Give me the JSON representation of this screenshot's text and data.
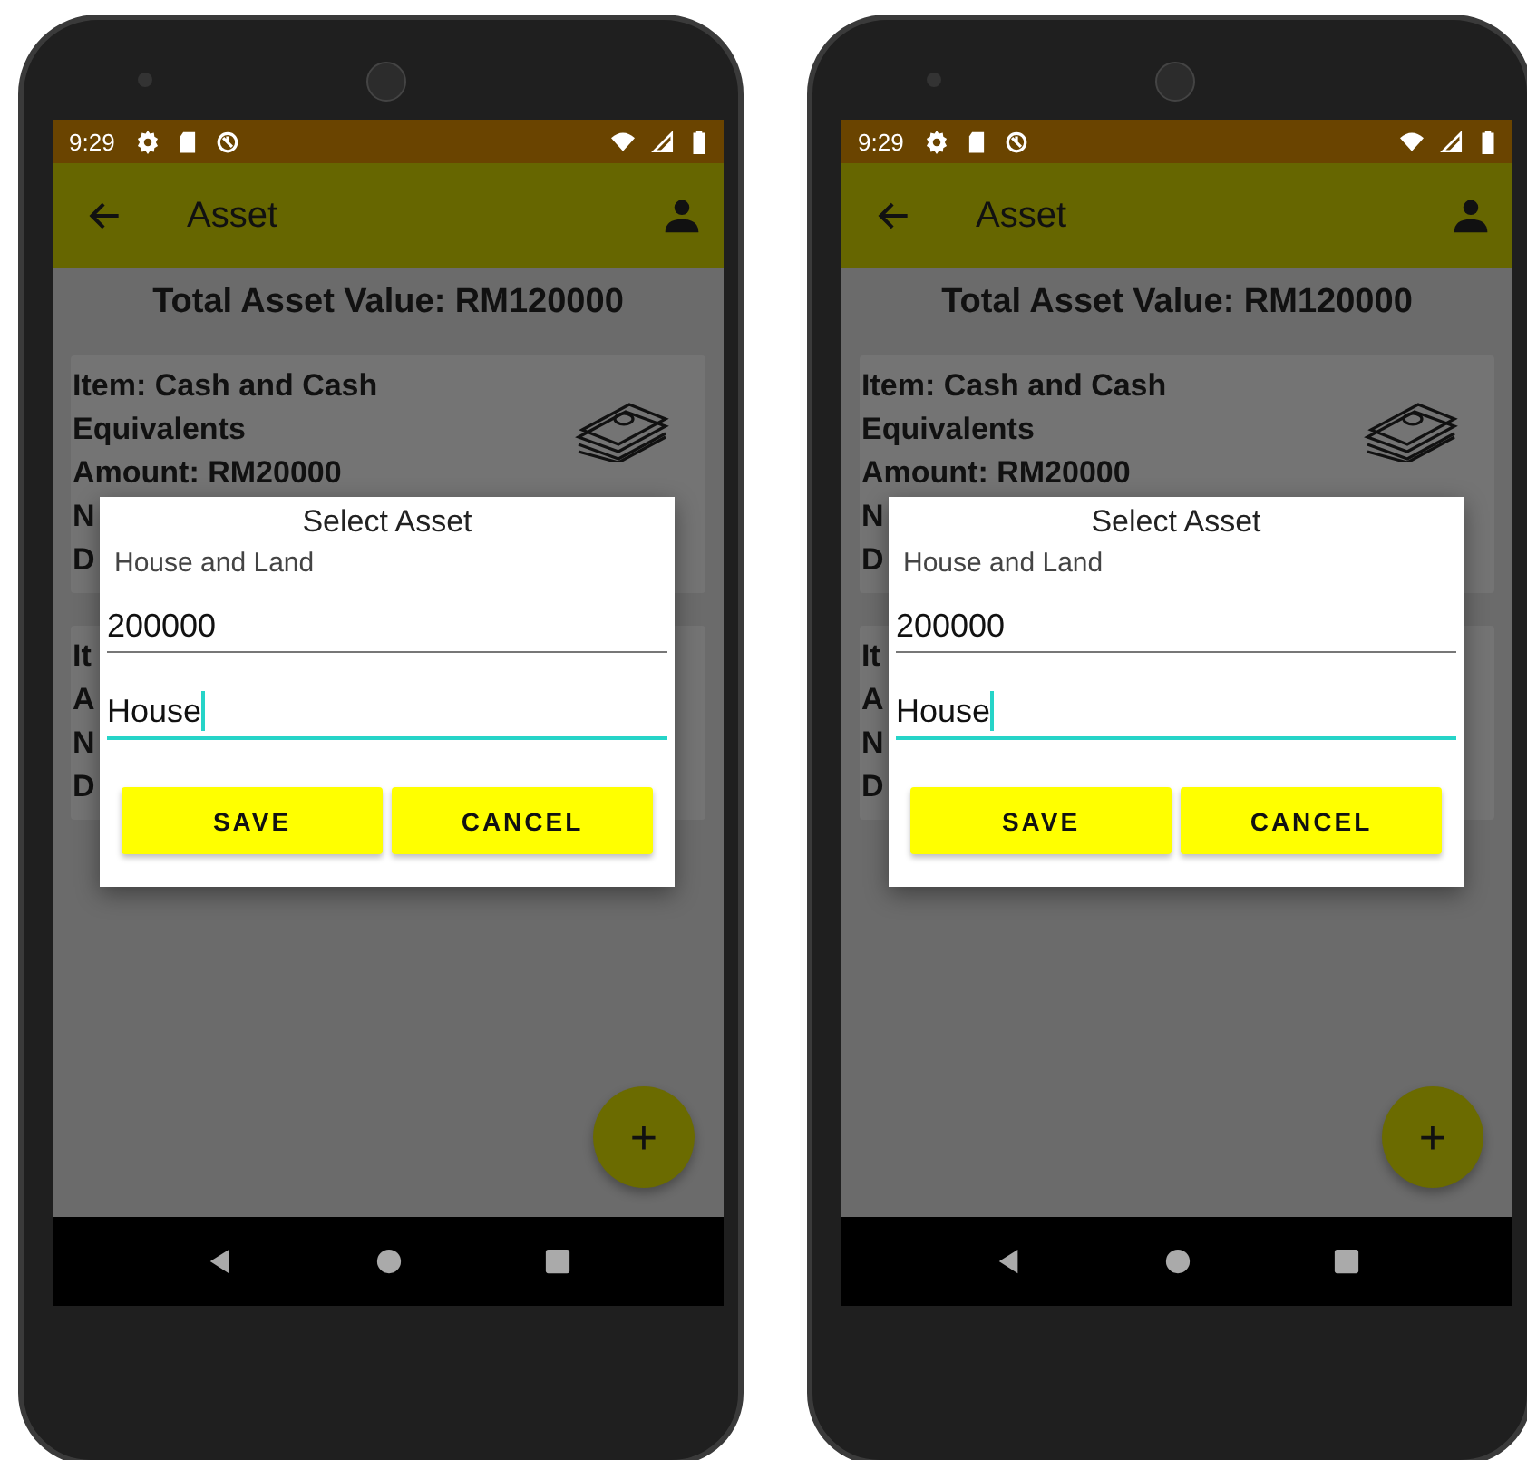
{
  "phones": [
    {
      "status_bar": {
        "time": "9:29"
      },
      "app_bar": {
        "title": "Asset"
      },
      "total": "Total Asset Value: RM120000",
      "cards": [
        {
          "kind": "money",
          "lines": [
            "Item: Cash and Cash Equivalents",
            "Amount: RM20000",
            "N",
            "D"
          ]
        },
        {
          "kind": "plain",
          "lines": [
            "It",
            "A",
            "N",
            "D"
          ]
        }
      ],
      "dialog": {
        "title": "Select Asset",
        "selection": "House and Land",
        "fields": [
          {
            "value": "200000",
            "focused": false
          },
          {
            "value": "House",
            "focused": true
          }
        ],
        "buttons": [
          "SAVE",
          "CANCEL"
        ]
      },
      "fab": "+"
    },
    {
      "status_bar": {
        "time": "9:29"
      },
      "app_bar": {
        "title": "Asset"
      },
      "total": "Total Asset Value: RM120000",
      "cards": [
        {
          "kind": "money",
          "lines": [
            "Item: Cash and Cash Equivalents",
            "Amount: RM20000",
            "N",
            "D"
          ]
        },
        {
          "kind": "plain",
          "lines": [
            "It",
            "A",
            "N",
            "D"
          ]
        }
      ],
      "dialog": {
        "title": "Select Asset",
        "selection": "House and Land",
        "fields": [
          {
            "value": "200000",
            "focused": false
          },
          {
            "value": "House",
            "focused": true
          }
        ],
        "buttons": [
          "SAVE",
          "CANCEL"
        ]
      },
      "fab": "+"
    }
  ]
}
